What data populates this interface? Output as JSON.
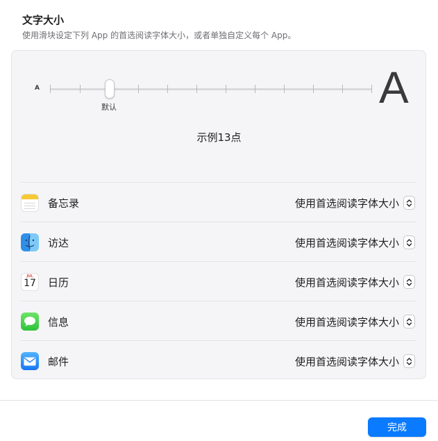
{
  "header": {
    "title": "文字大小",
    "subtitle": "使用滑块设定下列 App 的首选阅读字体大小，或者单独自定义每个 App。"
  },
  "slider": {
    "min_label": "A",
    "max_label": "A",
    "default_label": "默认",
    "tick_count": 12,
    "selected_index": 2
  },
  "sample": {
    "text": "示例13点"
  },
  "apps": [
    {
      "name": "备忘录",
      "setting": "使用首选阅读字体大小",
      "icon": "notes-icon"
    },
    {
      "name": "访达",
      "setting": "使用首选阅读字体大小",
      "icon": "finder-icon"
    },
    {
      "name": "日历",
      "setting": "使用首选阅读字体大小",
      "icon": "calendar-icon",
      "icon_month": "JUL",
      "icon_day": "17"
    },
    {
      "name": "信息",
      "setting": "使用首选阅读字体大小",
      "icon": "messages-icon"
    },
    {
      "name": "邮件",
      "setting": "使用首选阅读字体大小",
      "icon": "mail-icon"
    }
  ],
  "footer": {
    "done_label": "完成"
  },
  "colors": {
    "accent": "#0a7aff",
    "panel_bg": "#f5f5f7"
  }
}
